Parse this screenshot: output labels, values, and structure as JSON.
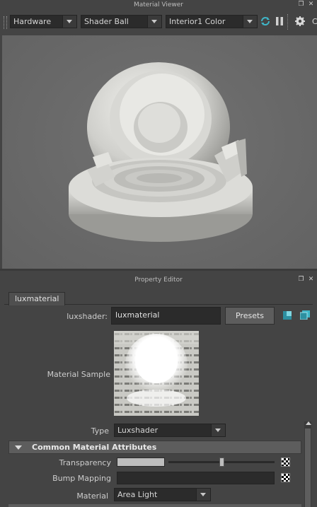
{
  "viewer": {
    "title": "Material Viewer",
    "renderer": "Hardware",
    "geometry": "Shader Ball",
    "environment": "Interior1 Color",
    "truncated_label": "C"
  },
  "property_editor": {
    "title": "Property Editor",
    "tab": "luxmaterial",
    "shader_label": "luxshader:",
    "shader_value": "luxmaterial",
    "presets_label": "Presets",
    "material_sample_label": "Material Sample",
    "type_label": "Type",
    "type_value": "Luxshader",
    "section_title": "Common Material Attributes",
    "transparency_label": "Transparency",
    "transparency_value": 0.5,
    "bump_label": "Bump Mapping",
    "material_label": "Material",
    "material_value": "Area Light"
  },
  "colors": {
    "panel_bg": "#444444",
    "field_bg": "#2b2b2b",
    "viewport_bg": "#6b6b6b",
    "accent_cyan": "#3fb6c8"
  }
}
